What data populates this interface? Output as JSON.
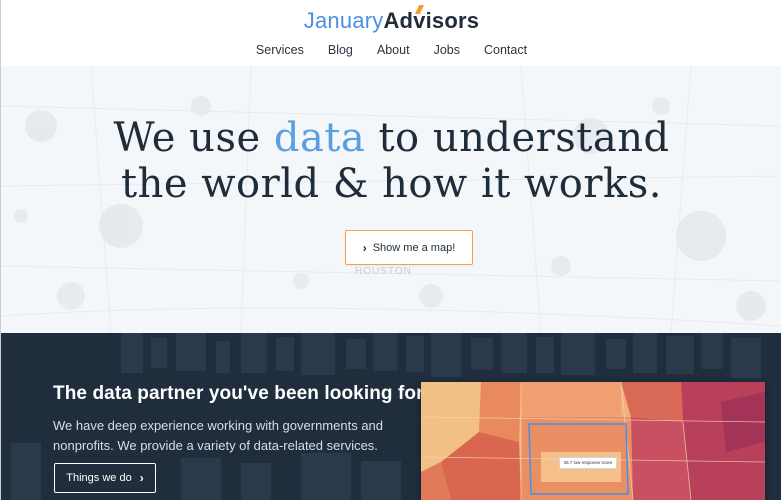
{
  "header": {
    "logo_part1": "January",
    "logo_part2": "Advisors",
    "nav": [
      "Services",
      "Blog",
      "About",
      "Jobs",
      "Contact"
    ]
  },
  "hero": {
    "headline_pre": "We use ",
    "headline_highlight": "data",
    "headline_post1": " to understand",
    "headline_line2": "the world & how it works.",
    "cta_label": "Show me a map!",
    "background_label": "HOUSTON"
  },
  "partner": {
    "title": "The data partner you've been looking for.",
    "text": "We have deep experience working with governments and nonprofits. We provide a variety of data-related services.",
    "button_label": "Things we do"
  },
  "map": {
    "tooltip": "35.7 low response score"
  },
  "colors": {
    "brand_blue": "#4a90e2",
    "brand_dark": "#1f2c3a",
    "accent_orange": "#f3a14a",
    "section_dark": "#1f2d3c"
  }
}
